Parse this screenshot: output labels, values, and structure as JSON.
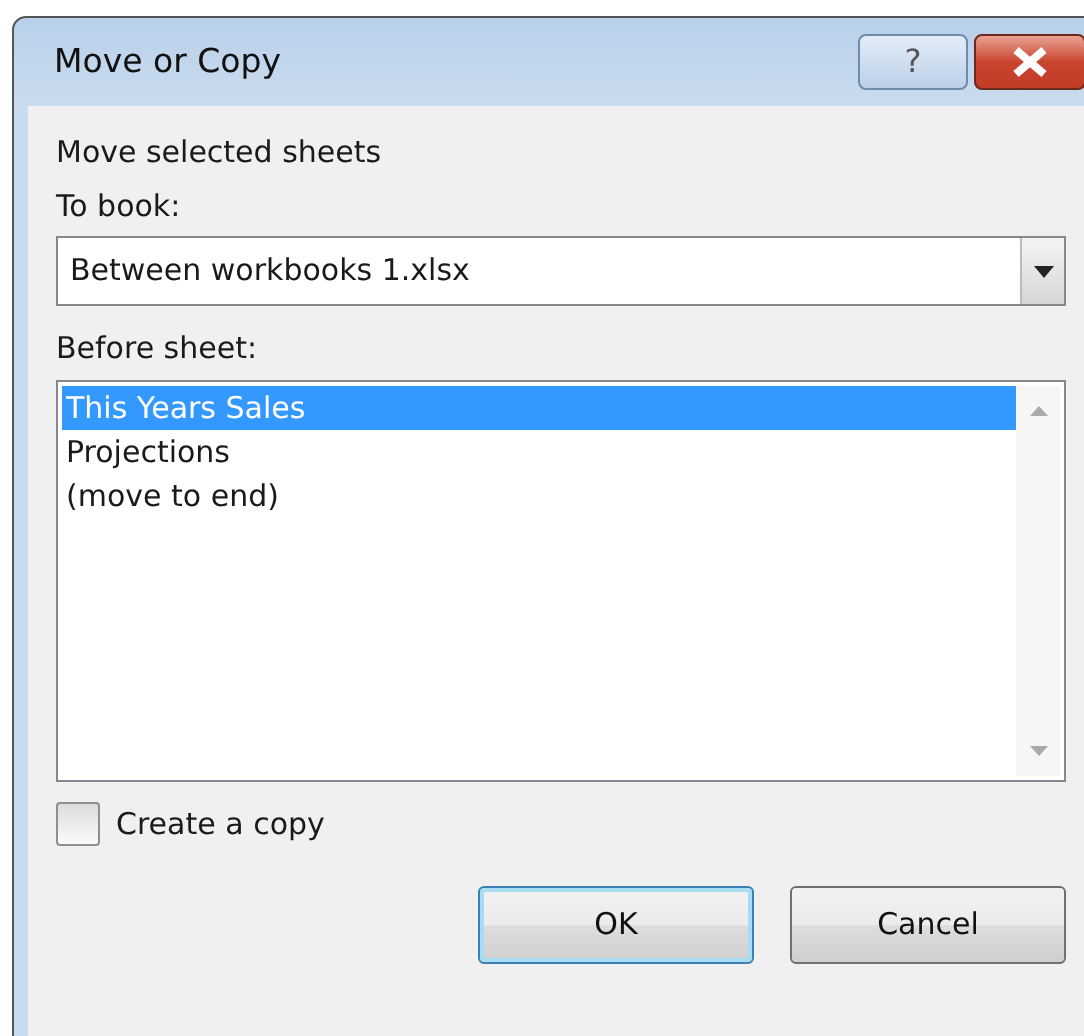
{
  "window": {
    "title": "Move or Copy",
    "help_button": "?"
  },
  "heading": "Move selected sheets",
  "to_book": {
    "label": "To book:",
    "value": "Between workbooks 1.xlsx"
  },
  "before_sheet": {
    "label": "Before sheet:",
    "items": [
      {
        "label": "This Years Sales",
        "selected": true
      },
      {
        "label": "Projections",
        "selected": false
      },
      {
        "label": "(move to end)",
        "selected": false
      }
    ]
  },
  "create_copy": {
    "label": "Create a copy",
    "checked": false
  },
  "buttons": [
    {
      "label": "OK",
      "default": true
    },
    {
      "label": "Cancel",
      "default": false
    }
  ]
}
